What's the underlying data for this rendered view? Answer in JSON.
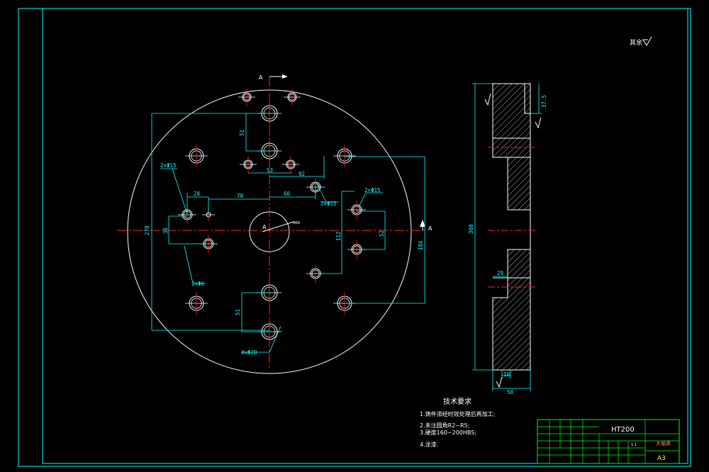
{
  "colors": {
    "background": "#000000",
    "frame": "#00ffff",
    "outline": "#ffffff",
    "dimension": "#00ffff",
    "centerline": "#ff2020",
    "table": "#00ff00",
    "hatch": "#ffffff"
  },
  "title_block": {
    "material": "HT200",
    "sheet_size": "A3",
    "scale": "1:1",
    "part_name": "大轴承"
  },
  "roughness_note": "其余",
  "section_label": "A",
  "diameter_label": "A",
  "tech_requirements": {
    "title": "技术要求",
    "items": [
      "1.铸件须经时效处理后再加工;",
      "2.未注圆角R2~R5;",
      "3.硬度160~200HBS;",
      "4.涂漆."
    ]
  },
  "dimensions": {
    "front": {
      "d278": "278",
      "d51_top": "51",
      "d53": "53",
      "d92": "92",
      "d28": "28",
      "d78": "78",
      "d60": "60",
      "d36": "36",
      "d112": "112",
      "d52": "52",
      "d184": "184",
      "d51_bottom": "51",
      "bore": "Φ66",
      "n2x15_left": "2×Φ15",
      "n2x15_mid": "2×Φ15",
      "n2x15_right": "2×Φ15",
      "n2x6": "2×Φ6",
      "n4x20": "4×Φ20"
    },
    "side": {
      "d360": "360",
      "d37_5": "37.5",
      "d29": "29",
      "d10": "10",
      "d50": "50"
    }
  }
}
